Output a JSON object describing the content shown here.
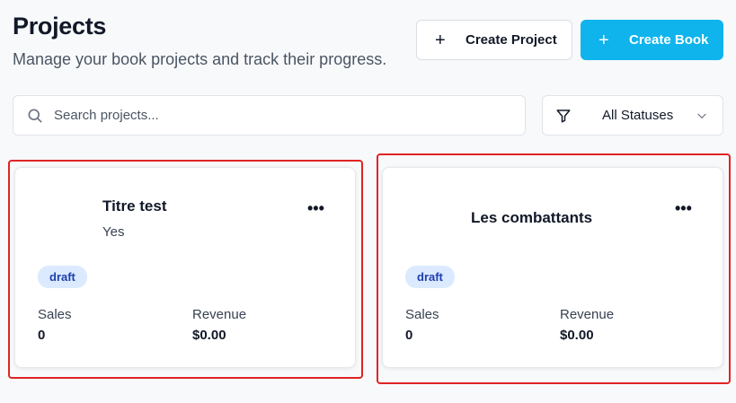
{
  "header": {
    "title": "Projects",
    "subtitle": "Manage your book projects and track their progress.",
    "create_project_label": "Create Project",
    "create_book_label": "Create Book"
  },
  "filters": {
    "search_placeholder": "Search projects...",
    "search_value": "",
    "status_selected": "All Statuses"
  },
  "projects": [
    {
      "title": "Titre test",
      "subtitle": "Yes",
      "status": "draft",
      "sales_label": "Sales",
      "sales_value": "0",
      "revenue_label": "Revenue",
      "revenue_value": "$0.00",
      "highlighted": true
    },
    {
      "title": "Les combattants",
      "subtitle": "",
      "status": "draft",
      "sales_label": "Sales",
      "sales_value": "0",
      "revenue_label": "Revenue",
      "revenue_value": "$0.00",
      "highlighted": true
    }
  ],
  "icons": {
    "plus": "plus-icon",
    "search": "search-icon",
    "filter": "filter-icon",
    "chevron": "chevron-down-icon",
    "more": "more-horizontal-icon"
  },
  "colors": {
    "primary": "#0fb4ec",
    "badge_bg": "#dbeafe",
    "badge_text": "#1e40af",
    "highlight": "#e02424"
  }
}
